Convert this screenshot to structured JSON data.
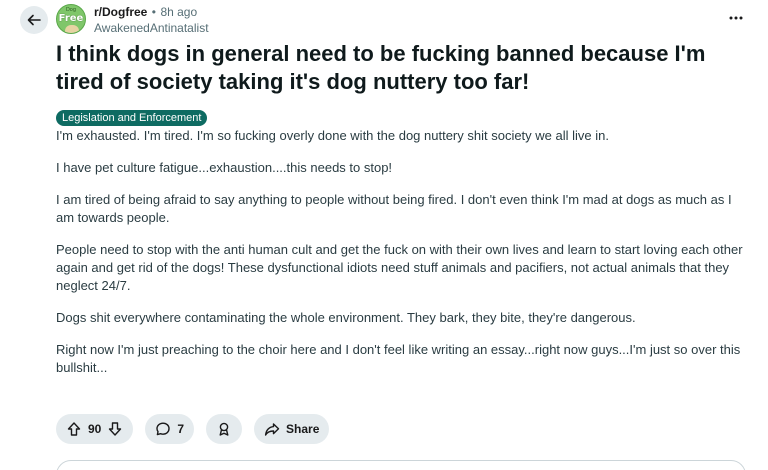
{
  "header": {
    "subreddit": "r/Dogfree",
    "separator": "•",
    "time": "8h ago",
    "author": "AwakenedAntinatalist",
    "avatar": {
      "small_text": "Dog",
      "big_text": "Free"
    }
  },
  "post": {
    "title": "I think dogs in general need to be fucking banned because I'm tired of society taking it's dog nuttery too far!",
    "flair": "Legislation and Enforcement",
    "paragraphs": [
      "I'm exhausted. I'm tired. I'm so fucking overly done with the dog nuttery shit society we all live in.",
      "I have pet culture fatigue...exhaustion....this needs to stop!",
      "I am tired of being afraid to say anything to people without being fired. I don't even think I'm mad at dogs as much as I am towards people.",
      "People need to stop with the anti human cult and get the fuck on with their own lives and learn to start loving each other again and get rid of the dogs! These dysfunctional idiots need stuff animals and pacifiers, not actual animals that they neglect 24/7.",
      "Dogs shit everywhere contaminating the whole environment. They bark, they bite, they're dangerous.",
      "Right now I'm just preaching to the choir here and I don't feel like writing an essay...right now guys...I'm just so over this bullshit..."
    ]
  },
  "actions": {
    "votes": "90",
    "comments": "7",
    "share_label": "Share"
  },
  "colors": {
    "flair_bg": "#0e6b62",
    "pill_bg": "#e5ebee"
  }
}
